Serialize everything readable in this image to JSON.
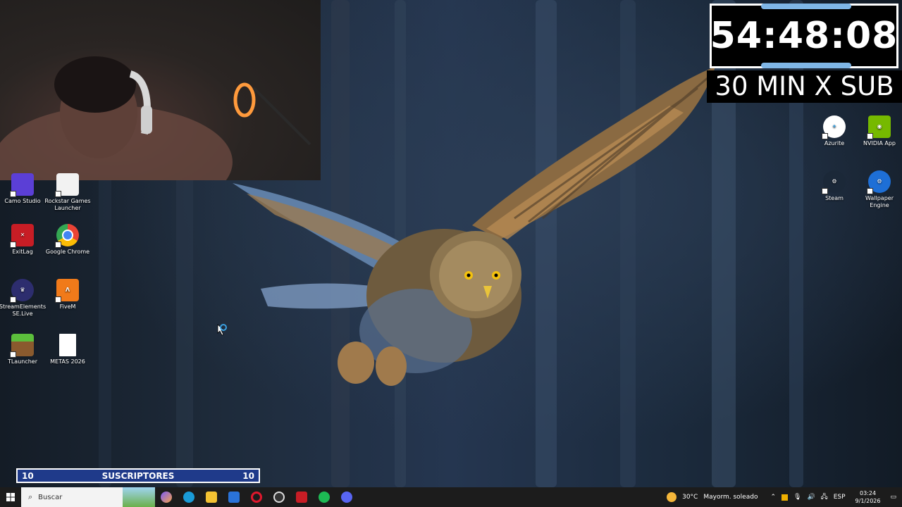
{
  "overlay": {
    "timer": "54:48:08",
    "subtitle": "30 MIN X SUB"
  },
  "subscriber_bar": {
    "left_count": "10",
    "label": "SUSCRIPTORES",
    "right_count": "10"
  },
  "desktop_icons_left": [
    {
      "label": "Camo Studio",
      "icon": "camo-studio-icon",
      "color": "#5b3fd6"
    },
    {
      "label": "Rockstar Games Launcher",
      "icon": "rockstar-icon",
      "color": "#f2f2f2"
    },
    {
      "label": "ExitLag",
      "icon": "exitlag-icon",
      "color": "#c81d25"
    },
    {
      "label": "Google Chrome",
      "icon": "chrome-icon",
      "color": "#4285f4"
    },
    {
      "label": "StreamElements SE.Live",
      "icon": "streamelements-icon",
      "color": "#2d2d6e"
    },
    {
      "label": "FiveM",
      "icon": "fivem-icon",
      "color": "#f07a1a"
    },
    {
      "label": "TLauncher",
      "icon": "tlauncher-icon",
      "color": "#4caf3a"
    },
    {
      "label": "METAS 2026",
      "icon": "text-file-icon",
      "color": "#ffffff"
    }
  ],
  "desktop_icons_right": [
    {
      "label": "Azurite",
      "icon": "azurite-icon",
      "color": "#3aa0e0"
    },
    {
      "label": "NVIDIA App",
      "icon": "nvidia-icon",
      "color": "#76b900"
    },
    {
      "label": "Steam",
      "icon": "steam-icon",
      "color": "#1b2838"
    },
    {
      "label": "Wallpaper Engine",
      "icon": "wallpaper-engine-icon",
      "color": "#1e6fd6"
    }
  ],
  "taskbar": {
    "search_placeholder": "Buscar",
    "apps": [
      {
        "name": "copilot-icon",
        "color": "#7a5af8"
      },
      {
        "name": "edge-icon",
        "color": "#1a9bd7"
      },
      {
        "name": "file-explorer-icon",
        "color": "#f3c232"
      },
      {
        "name": "outlook-icon",
        "color": "#2a73d9"
      },
      {
        "name": "opera-icon",
        "color": "#e0182d"
      },
      {
        "name": "obs-icon",
        "color": "#dddddd"
      },
      {
        "name": "exitlag-icon",
        "color": "#c81d25"
      },
      {
        "name": "spotify-icon",
        "color": "#1db954"
      },
      {
        "name": "discord-icon",
        "color": "#5865f2"
      }
    ],
    "weather_temp": "30°C",
    "weather_desc": "Mayorm. soleado",
    "language": "ESP",
    "time": "03:24",
    "date": "9/1/2026"
  }
}
